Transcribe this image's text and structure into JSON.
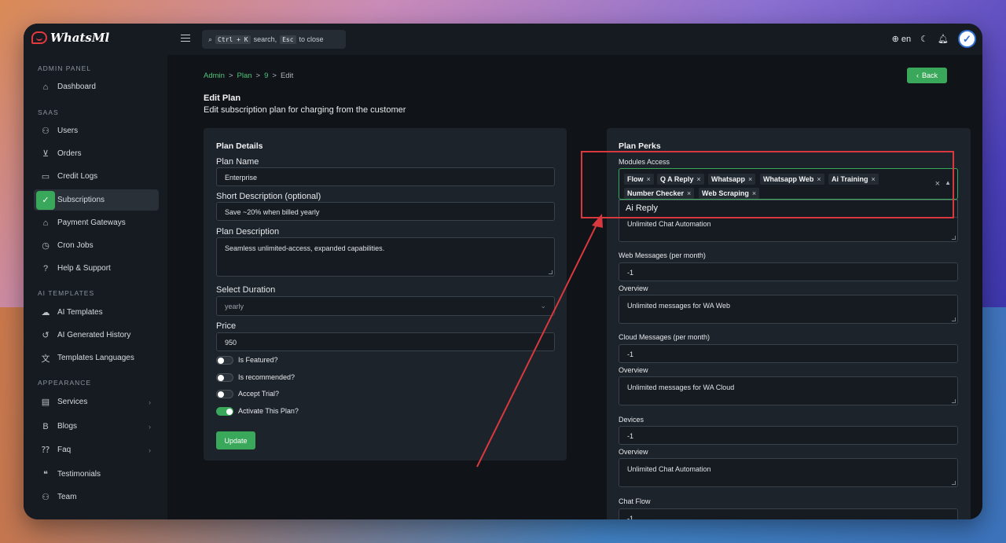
{
  "app": {
    "name": "WhatsMl"
  },
  "sidebar": {
    "sections": [
      {
        "label": "ADMIN PANEL"
      },
      {
        "label": "SAAS"
      },
      {
        "label": "AI TEMPLATES"
      },
      {
        "label": "APPEARANCE"
      }
    ],
    "items": [
      {
        "label": "Dashboard",
        "icon": "home-icon"
      },
      {
        "label": "Users",
        "icon": "users-icon"
      },
      {
        "label": "Orders",
        "icon": "cart-icon"
      },
      {
        "label": "Credit Logs",
        "icon": "card-icon"
      },
      {
        "label": "Subscriptions",
        "icon": "subscriptions-icon",
        "active": true
      },
      {
        "label": "Payment Gateways",
        "icon": "bank-icon"
      },
      {
        "label": "Cron Jobs",
        "icon": "clock-icon"
      },
      {
        "label": "Help & Support",
        "icon": "help-icon"
      },
      {
        "label": "AI Templates",
        "icon": "ai-icon"
      },
      {
        "label": "AI Generated History",
        "icon": "history-icon"
      },
      {
        "label": "Templates Languages",
        "icon": "translate-icon"
      },
      {
        "label": "Services",
        "icon": "services-icon"
      },
      {
        "label": "Blogs",
        "icon": "blog-icon"
      },
      {
        "label": "Faq",
        "icon": "faq-icon"
      },
      {
        "label": "Testimonials",
        "icon": "testimonial-icon"
      },
      {
        "label": "Team",
        "icon": "team-icon"
      }
    ]
  },
  "topbar": {
    "search_kbd1": "Ctrl + K",
    "search_text1": "search,",
    "search_kbd2": "Esc",
    "search_text2": "to close",
    "lang": "en"
  },
  "breadcrumb": {
    "c1": "Admin",
    "c2": "Plan",
    "c3": "9",
    "c4": "Edit",
    "sep": ">"
  },
  "back_label": "Back",
  "page": {
    "title": "Edit Plan",
    "subtitle": "Edit subscription plan for charging from the customer"
  },
  "details": {
    "title": "Plan Details",
    "plan_name_label": "Plan Name",
    "plan_name": "Enterprise",
    "short_desc_label": "Short Description (optional)",
    "short_desc": "Save ~20% when billed yearly",
    "desc_label": "Plan Description",
    "desc": "Seamless unlimited-access, expanded capabilities.",
    "duration_label": "Select Duration",
    "duration": "yearly",
    "price_label": "Price",
    "price": "950",
    "toggles": [
      {
        "label": "Is Featured?",
        "on": false
      },
      {
        "label": "Is recommended?",
        "on": false
      },
      {
        "label": "Accept Trial?",
        "on": false
      },
      {
        "label": "Activate This Plan?",
        "on": true
      }
    ],
    "update_label": "Update"
  },
  "perks": {
    "title": "Plan Perks",
    "modules_label": "Modules Access",
    "tags": [
      "Flow",
      "Q A Reply",
      "Whatsapp",
      "Whatsapp Web",
      "Ai Training",
      "Number Checker",
      "Web Scraping"
    ],
    "dropdown_option": "Ai Reply",
    "overview1": "Unlimited Chat Automation",
    "web_label": "Web Messages (per month)",
    "web_value": "-1",
    "overview_label": "Overview",
    "web_overview": "Unlimited messages for WA Web",
    "cloud_label": "Cloud Messages (per month)",
    "cloud_value": "-1",
    "cloud_overview": "Unlimited messages for WA Cloud",
    "devices_label": "Devices",
    "devices_value": "-1",
    "devices_overview": "Unlimited Chat Automation",
    "chatflow_label": "Chat Flow",
    "chatflow_value": "-1"
  },
  "colors": {
    "accent": "#3aa85a",
    "highlight": "#d9393e",
    "background": "#101418"
  }
}
